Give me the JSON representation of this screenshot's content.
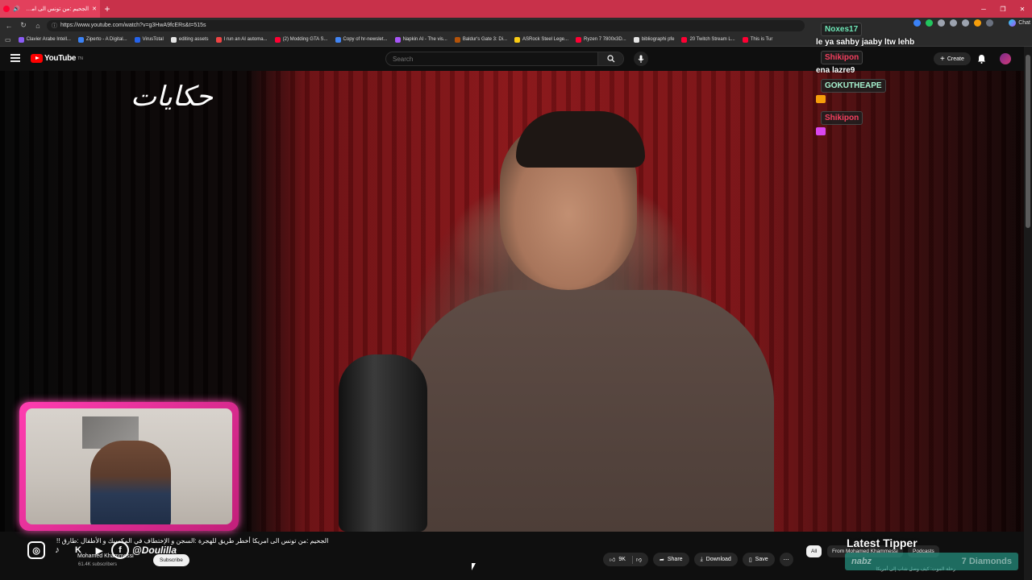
{
  "browser": {
    "tab_title": "الجحيم :من تونس الى امريكا أخ",
    "url": "https://www.youtube.com/watch?v=g3HwA9fcERs&t=515s",
    "chat_button": "Chat",
    "bookmarks": [
      {
        "label": "Clavier Arabe Intell...",
        "color": "#8b5cf6"
      },
      {
        "label": "Ziperto - A Digital...",
        "color": "#3b82f6"
      },
      {
        "label": "VirusTotal",
        "color": "#2563eb"
      },
      {
        "label": "editing assets",
        "color": "#e5e5e5"
      },
      {
        "label": "I run an AI automa...",
        "color": "#ef4444"
      },
      {
        "label": "(2) Modding GTA S...",
        "color": "#ff0033"
      },
      {
        "label": "Copy of hr-newslet...",
        "color": "#4285f4"
      },
      {
        "label": "Napkin AI - The vis...",
        "color": "#a855f7"
      },
      {
        "label": "Baldur's Gate 3: Di...",
        "color": "#b45309"
      },
      {
        "label": "ASRock Steel Lege...",
        "color": "#facc15"
      },
      {
        "label": "Ryzen 7 7800x3D...",
        "color": "#ff0033"
      },
      {
        "label": "bibliographi pfe",
        "color": "#e5e5e5"
      },
      {
        "label": "20 Twitch Stream L...",
        "color": "#ff0033"
      },
      {
        "label": "This is Tur",
        "color": "#ff0033"
      }
    ]
  },
  "youtube": {
    "logo_text": "YouTube",
    "logo_sup": "TN",
    "search_placeholder": "Search",
    "create_label": "Create"
  },
  "video": {
    "overlay_logo": "حكايات",
    "title": "الجحيم :من تونس الى امريكا أخطر طريق للهجرة :السجن و الإختطاف في المكسيك و الأطفال :طارق !!",
    "channel": "Mohamed Khammessi",
    "subscribers": "61.4K subscribers",
    "subscribe_label": "Subscribe",
    "social_handle": "@Doulilla",
    "likes": "9K",
    "share_label": "Share",
    "download_label": "Download",
    "save_label": "Save"
  },
  "recommendations": {
    "chips": [
      "All",
      "From Mohamed Khammessi",
      "Podcasts"
    ],
    "first_title": "رحلة الموت: كيف وصل شاب إلى أمريكا"
  },
  "stream": {
    "latest_tipper_label": "Latest Tipper",
    "tipper_name": "nabz",
    "tipper_amount": "7 Diamonds"
  },
  "chat": [
    {
      "user": "Noxes17",
      "user_color": "#6ee7b7",
      "text": "le ya sahby jaaby ltw lehb"
    },
    {
      "user": "Shikipon",
      "user_color": "#f43f5e",
      "text": "ena lazre9"
    },
    {
      "user": "GOKUTHEAPE",
      "user_color": "#a7f3d0",
      "emoji_color": "#f59e0b"
    },
    {
      "user": "Shikipon",
      "user_color": "#f43f5e",
      "emoji_color": "#d946ef"
    }
  ]
}
